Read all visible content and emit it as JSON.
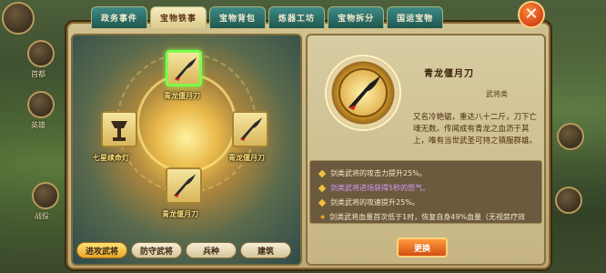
{
  "tabs": [
    {
      "label": "政务事件"
    },
    {
      "label": "宝物铁事"
    },
    {
      "label": "宝物背包"
    },
    {
      "label": "炼器工坊"
    },
    {
      "label": "宝物拆分"
    },
    {
      "label": "国运宝物"
    }
  ],
  "active_tab": 1,
  "slots": {
    "top": {
      "label": "青龙偃月刀",
      "selected": true,
      "icon": "blade-icon"
    },
    "left": {
      "label": "七星续命灯",
      "icon": "lamp-icon"
    },
    "right": {
      "label": "青龙偃月刀",
      "icon": "blade-icon"
    },
    "bottom": {
      "label": "青龙偃月刀",
      "icon": "blade-icon"
    }
  },
  "bottom_buttons": [
    {
      "label": "进攻武将",
      "active": true
    },
    {
      "label": "防守武将",
      "active": false
    },
    {
      "label": "兵种",
      "active": false
    },
    {
      "label": "建筑",
      "active": false
    }
  ],
  "item": {
    "name": "青龙偃月刀",
    "subtype": "武将类",
    "description": "又名冷艳锯，重达八十二斤，刀下亡魂无数。传闻成有青龙之血沥于其上，唯有当世武圣可持之镇服群雄。"
  },
  "effects": [
    {
      "text": "剑类武将的攻击力提升25%。",
      "style": "normal"
    },
    {
      "text": "剑类武将进场获得5秒的怒气。",
      "style": "purple"
    },
    {
      "text": "剑类武将的攻速提升25%。",
      "style": "normal"
    },
    {
      "text": "剑类武将血量首次低于1时，恢复自身49%血量（无视禁疗效",
      "style": "star"
    }
  ],
  "swap_button": "更换",
  "side_labels": [
    "首都",
    "英雄",
    "战役"
  ],
  "colors": {
    "selected_border": "#7dff4c",
    "accent": "#e6a629",
    "close": "#c3260c"
  }
}
